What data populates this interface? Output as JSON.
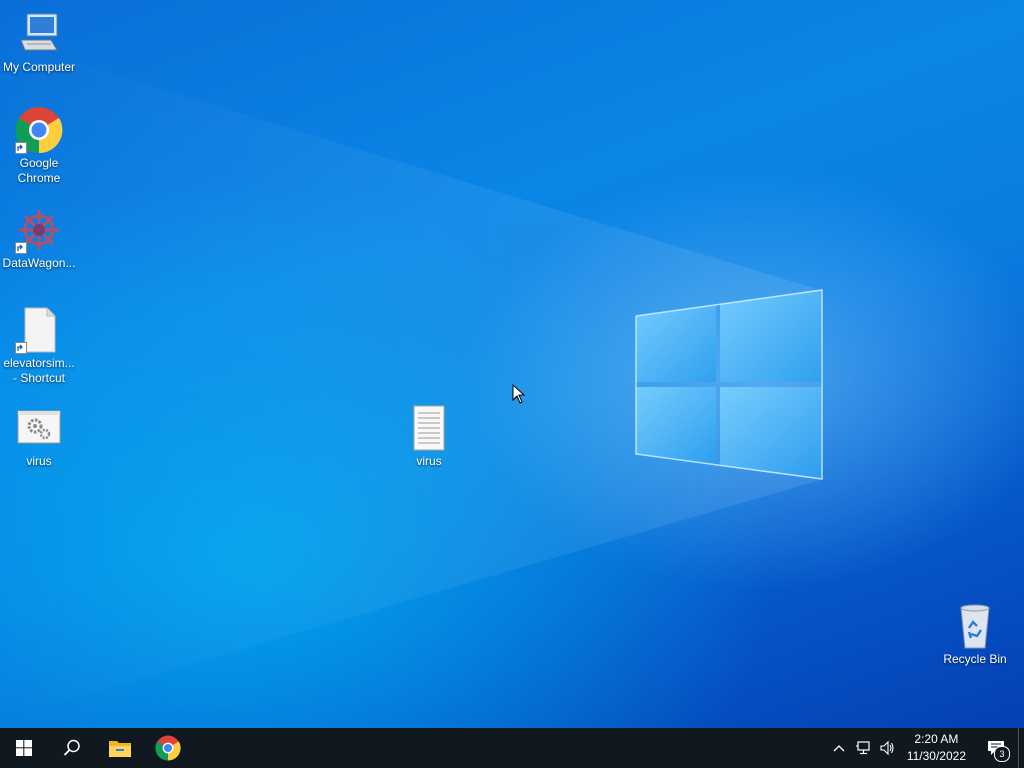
{
  "desktop": {
    "icons": [
      {
        "label": "My Computer",
        "icon": "computer-icon"
      },
      {
        "label": "Google Chrome",
        "icon": "chrome-icon",
        "shortcut": true
      },
      {
        "label": "DataWagon...",
        "icon": "datawagon-icon",
        "shortcut": true
      },
      {
        "label": "elevatorsim... - Shortcut",
        "icon": "blank-file-icon",
        "shortcut": true
      },
      {
        "label": "virus",
        "icon": "settings-file-icon"
      },
      {
        "label": "virus",
        "icon": "text-file-icon"
      },
      {
        "label": "Recycle Bin",
        "icon": "recycle-bin-icon"
      }
    ]
  },
  "taskbar": {
    "start": "windows-start-icon",
    "search": "search-icon",
    "pinned": [
      "file-explorer-icon",
      "chrome-icon"
    ],
    "tray": {
      "chevron": "chevron-up-icon",
      "network": "network-icon",
      "volume": "volume-icon"
    },
    "clock": {
      "time": "2:20 AM",
      "date": "11/30/2022"
    },
    "notifications": {
      "count": "3"
    }
  },
  "colors": {
    "taskbar": "#101820",
    "accent": "#0a78dc"
  }
}
